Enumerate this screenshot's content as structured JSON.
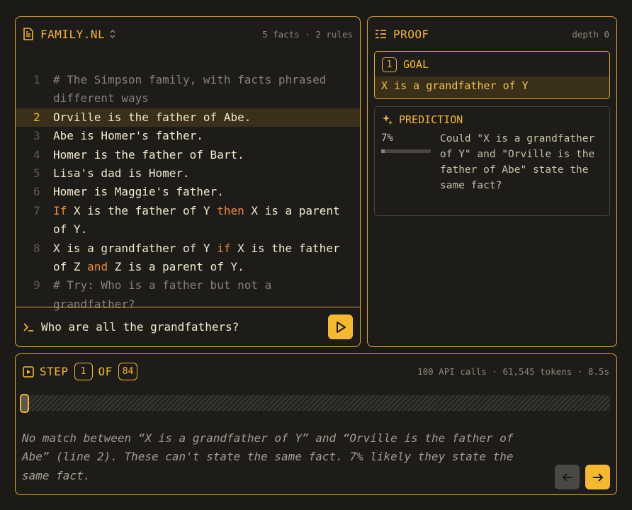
{
  "editor": {
    "filename": "FAMILY.NL",
    "meta": "5 facts · 2 rules",
    "lines": [
      {
        "n": "1",
        "text": "# The Simpson family, with facts phrased different ways"
      },
      {
        "n": "2",
        "text": "Orville is the father of Abe."
      },
      {
        "n": "3",
        "text": "Abe is Homer's father."
      },
      {
        "n": "4",
        "text": "Homer is the father of Bart."
      },
      {
        "n": "5",
        "text": "Lisa's dad is Homer."
      },
      {
        "n": "6",
        "text": "Homer is Maggie's father."
      },
      {
        "n": "7",
        "kw1": "If",
        "a": " X is the father of Y ",
        "kw2": "then",
        "b": " X is a parent of Y."
      },
      {
        "n": "8",
        "a": "X is a grandfather of Y ",
        "kw1": "if",
        "b": " X is the father of Z ",
        "kw2": "and",
        "c": " Z is a parent of Y."
      },
      {
        "n": "9",
        "text": "# Try: Who is a father but not a grandfather?"
      }
    ],
    "query": "Who are all the grandfathers?"
  },
  "proof": {
    "title": "PROOF",
    "depth": "depth 0",
    "goal": {
      "index": "1",
      "label": "GOAL",
      "text": "X is a grandfather of Y"
    },
    "prediction": {
      "label": "PREDICTION",
      "percent": "7%",
      "value": 0.07,
      "text": "Could \"X is a grandfather of Y\" and \"Orville is the father of Abe\" state the same fact?"
    }
  },
  "step": {
    "word_step": "STEP",
    "current": "1",
    "word_of": "OF",
    "total": "84",
    "stats": "100 API calls · 61,545 tokens · 8.5s",
    "explanation": "No match between “X is a grandfather of Y” and “Orville is the father of Abe” (line 2). These can't state the same fact. 7% likely they state the same fact."
  },
  "colors": {
    "accent": "#f5b82e",
    "keyword": "#ef8a3a",
    "background": "#1b1a17"
  },
  "icons": {
    "file": "document-icon",
    "sort": "chevron-updown-icon",
    "proof": "list-tree-icon",
    "prompt": "terminal-prompt-icon",
    "run": "play-icon",
    "predict": "sparkle-icon",
    "step": "step-play-icon",
    "prev": "arrow-left-icon",
    "next": "arrow-right-icon"
  }
}
